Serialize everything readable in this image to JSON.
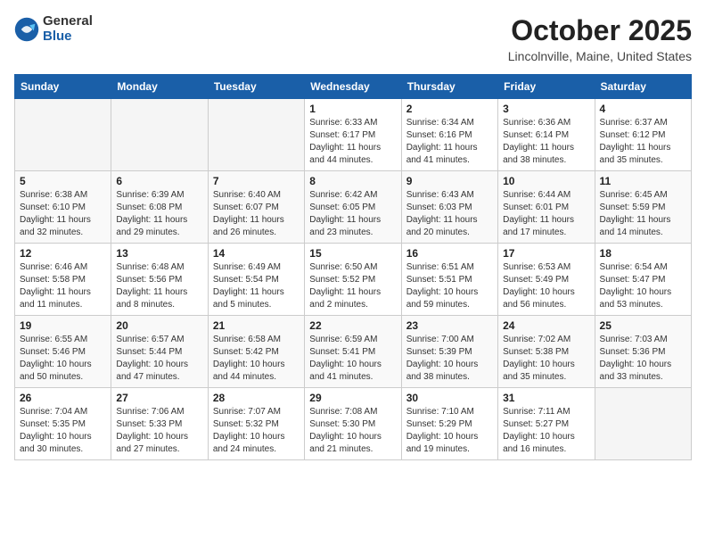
{
  "logo": {
    "general": "General",
    "blue": "Blue"
  },
  "header": {
    "title": "October 2025",
    "subtitle": "Lincolnville, Maine, United States"
  },
  "weekdays": [
    "Sunday",
    "Monday",
    "Tuesday",
    "Wednesday",
    "Thursday",
    "Friday",
    "Saturday"
  ],
  "weeks": [
    [
      {
        "day": "",
        "sunrise": "",
        "sunset": "",
        "daylight": ""
      },
      {
        "day": "",
        "sunrise": "",
        "sunset": "",
        "daylight": ""
      },
      {
        "day": "",
        "sunrise": "",
        "sunset": "",
        "daylight": ""
      },
      {
        "day": "1",
        "sunrise": "Sunrise: 6:33 AM",
        "sunset": "Sunset: 6:17 PM",
        "daylight": "Daylight: 11 hours and 44 minutes."
      },
      {
        "day": "2",
        "sunrise": "Sunrise: 6:34 AM",
        "sunset": "Sunset: 6:16 PM",
        "daylight": "Daylight: 11 hours and 41 minutes."
      },
      {
        "day": "3",
        "sunrise": "Sunrise: 6:36 AM",
        "sunset": "Sunset: 6:14 PM",
        "daylight": "Daylight: 11 hours and 38 minutes."
      },
      {
        "day": "4",
        "sunrise": "Sunrise: 6:37 AM",
        "sunset": "Sunset: 6:12 PM",
        "daylight": "Daylight: 11 hours and 35 minutes."
      }
    ],
    [
      {
        "day": "5",
        "sunrise": "Sunrise: 6:38 AM",
        "sunset": "Sunset: 6:10 PM",
        "daylight": "Daylight: 11 hours and 32 minutes."
      },
      {
        "day": "6",
        "sunrise": "Sunrise: 6:39 AM",
        "sunset": "Sunset: 6:08 PM",
        "daylight": "Daylight: 11 hours and 29 minutes."
      },
      {
        "day": "7",
        "sunrise": "Sunrise: 6:40 AM",
        "sunset": "Sunset: 6:07 PM",
        "daylight": "Daylight: 11 hours and 26 minutes."
      },
      {
        "day": "8",
        "sunrise": "Sunrise: 6:42 AM",
        "sunset": "Sunset: 6:05 PM",
        "daylight": "Daylight: 11 hours and 23 minutes."
      },
      {
        "day": "9",
        "sunrise": "Sunrise: 6:43 AM",
        "sunset": "Sunset: 6:03 PM",
        "daylight": "Daylight: 11 hours and 20 minutes."
      },
      {
        "day": "10",
        "sunrise": "Sunrise: 6:44 AM",
        "sunset": "Sunset: 6:01 PM",
        "daylight": "Daylight: 11 hours and 17 minutes."
      },
      {
        "day": "11",
        "sunrise": "Sunrise: 6:45 AM",
        "sunset": "Sunset: 5:59 PM",
        "daylight": "Daylight: 11 hours and 14 minutes."
      }
    ],
    [
      {
        "day": "12",
        "sunrise": "Sunrise: 6:46 AM",
        "sunset": "Sunset: 5:58 PM",
        "daylight": "Daylight: 11 hours and 11 minutes."
      },
      {
        "day": "13",
        "sunrise": "Sunrise: 6:48 AM",
        "sunset": "Sunset: 5:56 PM",
        "daylight": "Daylight: 11 hours and 8 minutes."
      },
      {
        "day": "14",
        "sunrise": "Sunrise: 6:49 AM",
        "sunset": "Sunset: 5:54 PM",
        "daylight": "Daylight: 11 hours and 5 minutes."
      },
      {
        "day": "15",
        "sunrise": "Sunrise: 6:50 AM",
        "sunset": "Sunset: 5:52 PM",
        "daylight": "Daylight: 11 hours and 2 minutes."
      },
      {
        "day": "16",
        "sunrise": "Sunrise: 6:51 AM",
        "sunset": "Sunset: 5:51 PM",
        "daylight": "Daylight: 10 hours and 59 minutes."
      },
      {
        "day": "17",
        "sunrise": "Sunrise: 6:53 AM",
        "sunset": "Sunset: 5:49 PM",
        "daylight": "Daylight: 10 hours and 56 minutes."
      },
      {
        "day": "18",
        "sunrise": "Sunrise: 6:54 AM",
        "sunset": "Sunset: 5:47 PM",
        "daylight": "Daylight: 10 hours and 53 minutes."
      }
    ],
    [
      {
        "day": "19",
        "sunrise": "Sunrise: 6:55 AM",
        "sunset": "Sunset: 5:46 PM",
        "daylight": "Daylight: 10 hours and 50 minutes."
      },
      {
        "day": "20",
        "sunrise": "Sunrise: 6:57 AM",
        "sunset": "Sunset: 5:44 PM",
        "daylight": "Daylight: 10 hours and 47 minutes."
      },
      {
        "day": "21",
        "sunrise": "Sunrise: 6:58 AM",
        "sunset": "Sunset: 5:42 PM",
        "daylight": "Daylight: 10 hours and 44 minutes."
      },
      {
        "day": "22",
        "sunrise": "Sunrise: 6:59 AM",
        "sunset": "Sunset: 5:41 PM",
        "daylight": "Daylight: 10 hours and 41 minutes."
      },
      {
        "day": "23",
        "sunrise": "Sunrise: 7:00 AM",
        "sunset": "Sunset: 5:39 PM",
        "daylight": "Daylight: 10 hours and 38 minutes."
      },
      {
        "day": "24",
        "sunrise": "Sunrise: 7:02 AM",
        "sunset": "Sunset: 5:38 PM",
        "daylight": "Daylight: 10 hours and 35 minutes."
      },
      {
        "day": "25",
        "sunrise": "Sunrise: 7:03 AM",
        "sunset": "Sunset: 5:36 PM",
        "daylight": "Daylight: 10 hours and 33 minutes."
      }
    ],
    [
      {
        "day": "26",
        "sunrise": "Sunrise: 7:04 AM",
        "sunset": "Sunset: 5:35 PM",
        "daylight": "Daylight: 10 hours and 30 minutes."
      },
      {
        "day": "27",
        "sunrise": "Sunrise: 7:06 AM",
        "sunset": "Sunset: 5:33 PM",
        "daylight": "Daylight: 10 hours and 27 minutes."
      },
      {
        "day": "28",
        "sunrise": "Sunrise: 7:07 AM",
        "sunset": "Sunset: 5:32 PM",
        "daylight": "Daylight: 10 hours and 24 minutes."
      },
      {
        "day": "29",
        "sunrise": "Sunrise: 7:08 AM",
        "sunset": "Sunset: 5:30 PM",
        "daylight": "Daylight: 10 hours and 21 minutes."
      },
      {
        "day": "30",
        "sunrise": "Sunrise: 7:10 AM",
        "sunset": "Sunset: 5:29 PM",
        "daylight": "Daylight: 10 hours and 19 minutes."
      },
      {
        "day": "31",
        "sunrise": "Sunrise: 7:11 AM",
        "sunset": "Sunset: 5:27 PM",
        "daylight": "Daylight: 10 hours and 16 minutes."
      },
      {
        "day": "",
        "sunrise": "",
        "sunset": "",
        "daylight": ""
      }
    ]
  ]
}
